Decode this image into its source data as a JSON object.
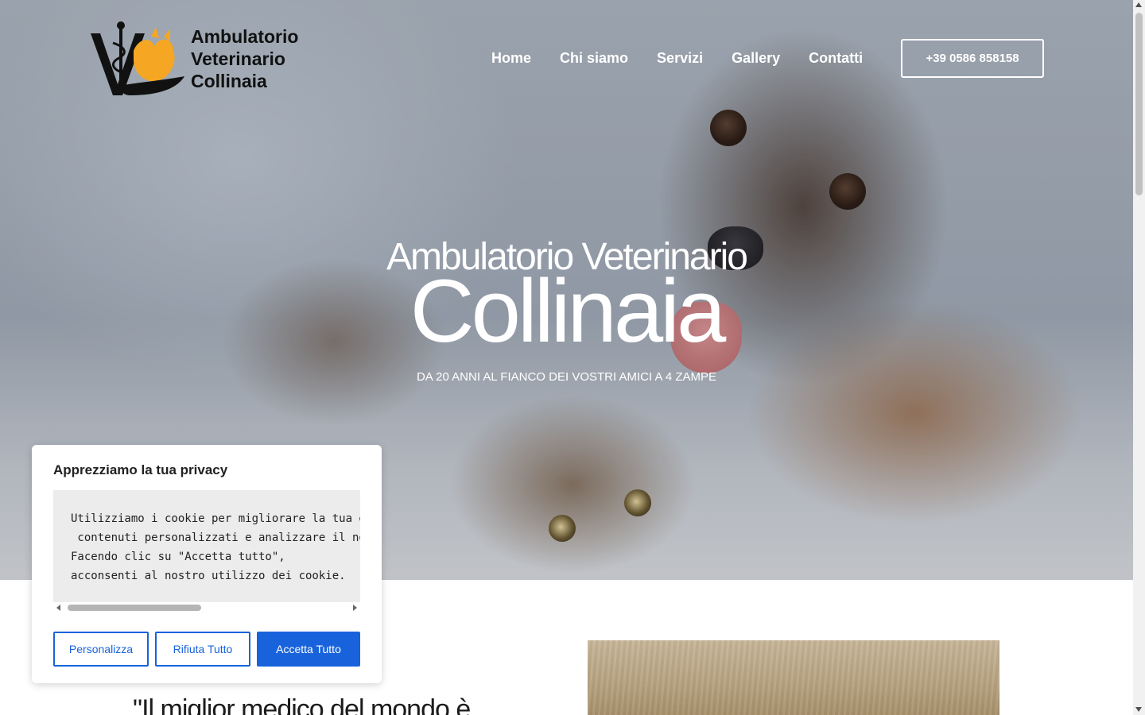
{
  "logo": {
    "line1": "Ambulatorio",
    "line2": "Veterinario",
    "line3": "Collinaia",
    "icon": "vet-caduceus-dog-cat-hand-logo"
  },
  "nav": {
    "items": [
      "Home",
      "Chi siamo",
      "Servizi",
      "Gallery",
      "Contatti"
    ],
    "phone": "+39 0586 858158"
  },
  "hero": {
    "title_line1": "Ambulatorio Veterinario",
    "title_line2": "Collinaia",
    "subtitle": "DA 20 ANNI AL FIANCO DEI VOSTRI AMICI A 4 ZAMPE",
    "image": "dog-and-cat-photo"
  },
  "content": {
    "quote_partial": "\"Il miglior medico del mondo è"
  },
  "cookie": {
    "title": "Apprezziamo la tua privacy",
    "body": "Utilizziamo i cookie per migliorare la tua esperienza di navigazione, offrire\n contenuti personalizzati e analizzare il nostro traffico.\nFacendo clic su \"Accetta tutto\",\nacconsenti al nostro utilizzo dei cookie.",
    "btn_customize": "Personalizza",
    "btn_reject": "Rifiuta Tutto",
    "btn_accept": "Accetta Tutto"
  },
  "colors": {
    "accent": "#1863dc",
    "logo_orange": "#f5a623",
    "logo_dark": "#111111",
    "white": "#ffffff"
  }
}
